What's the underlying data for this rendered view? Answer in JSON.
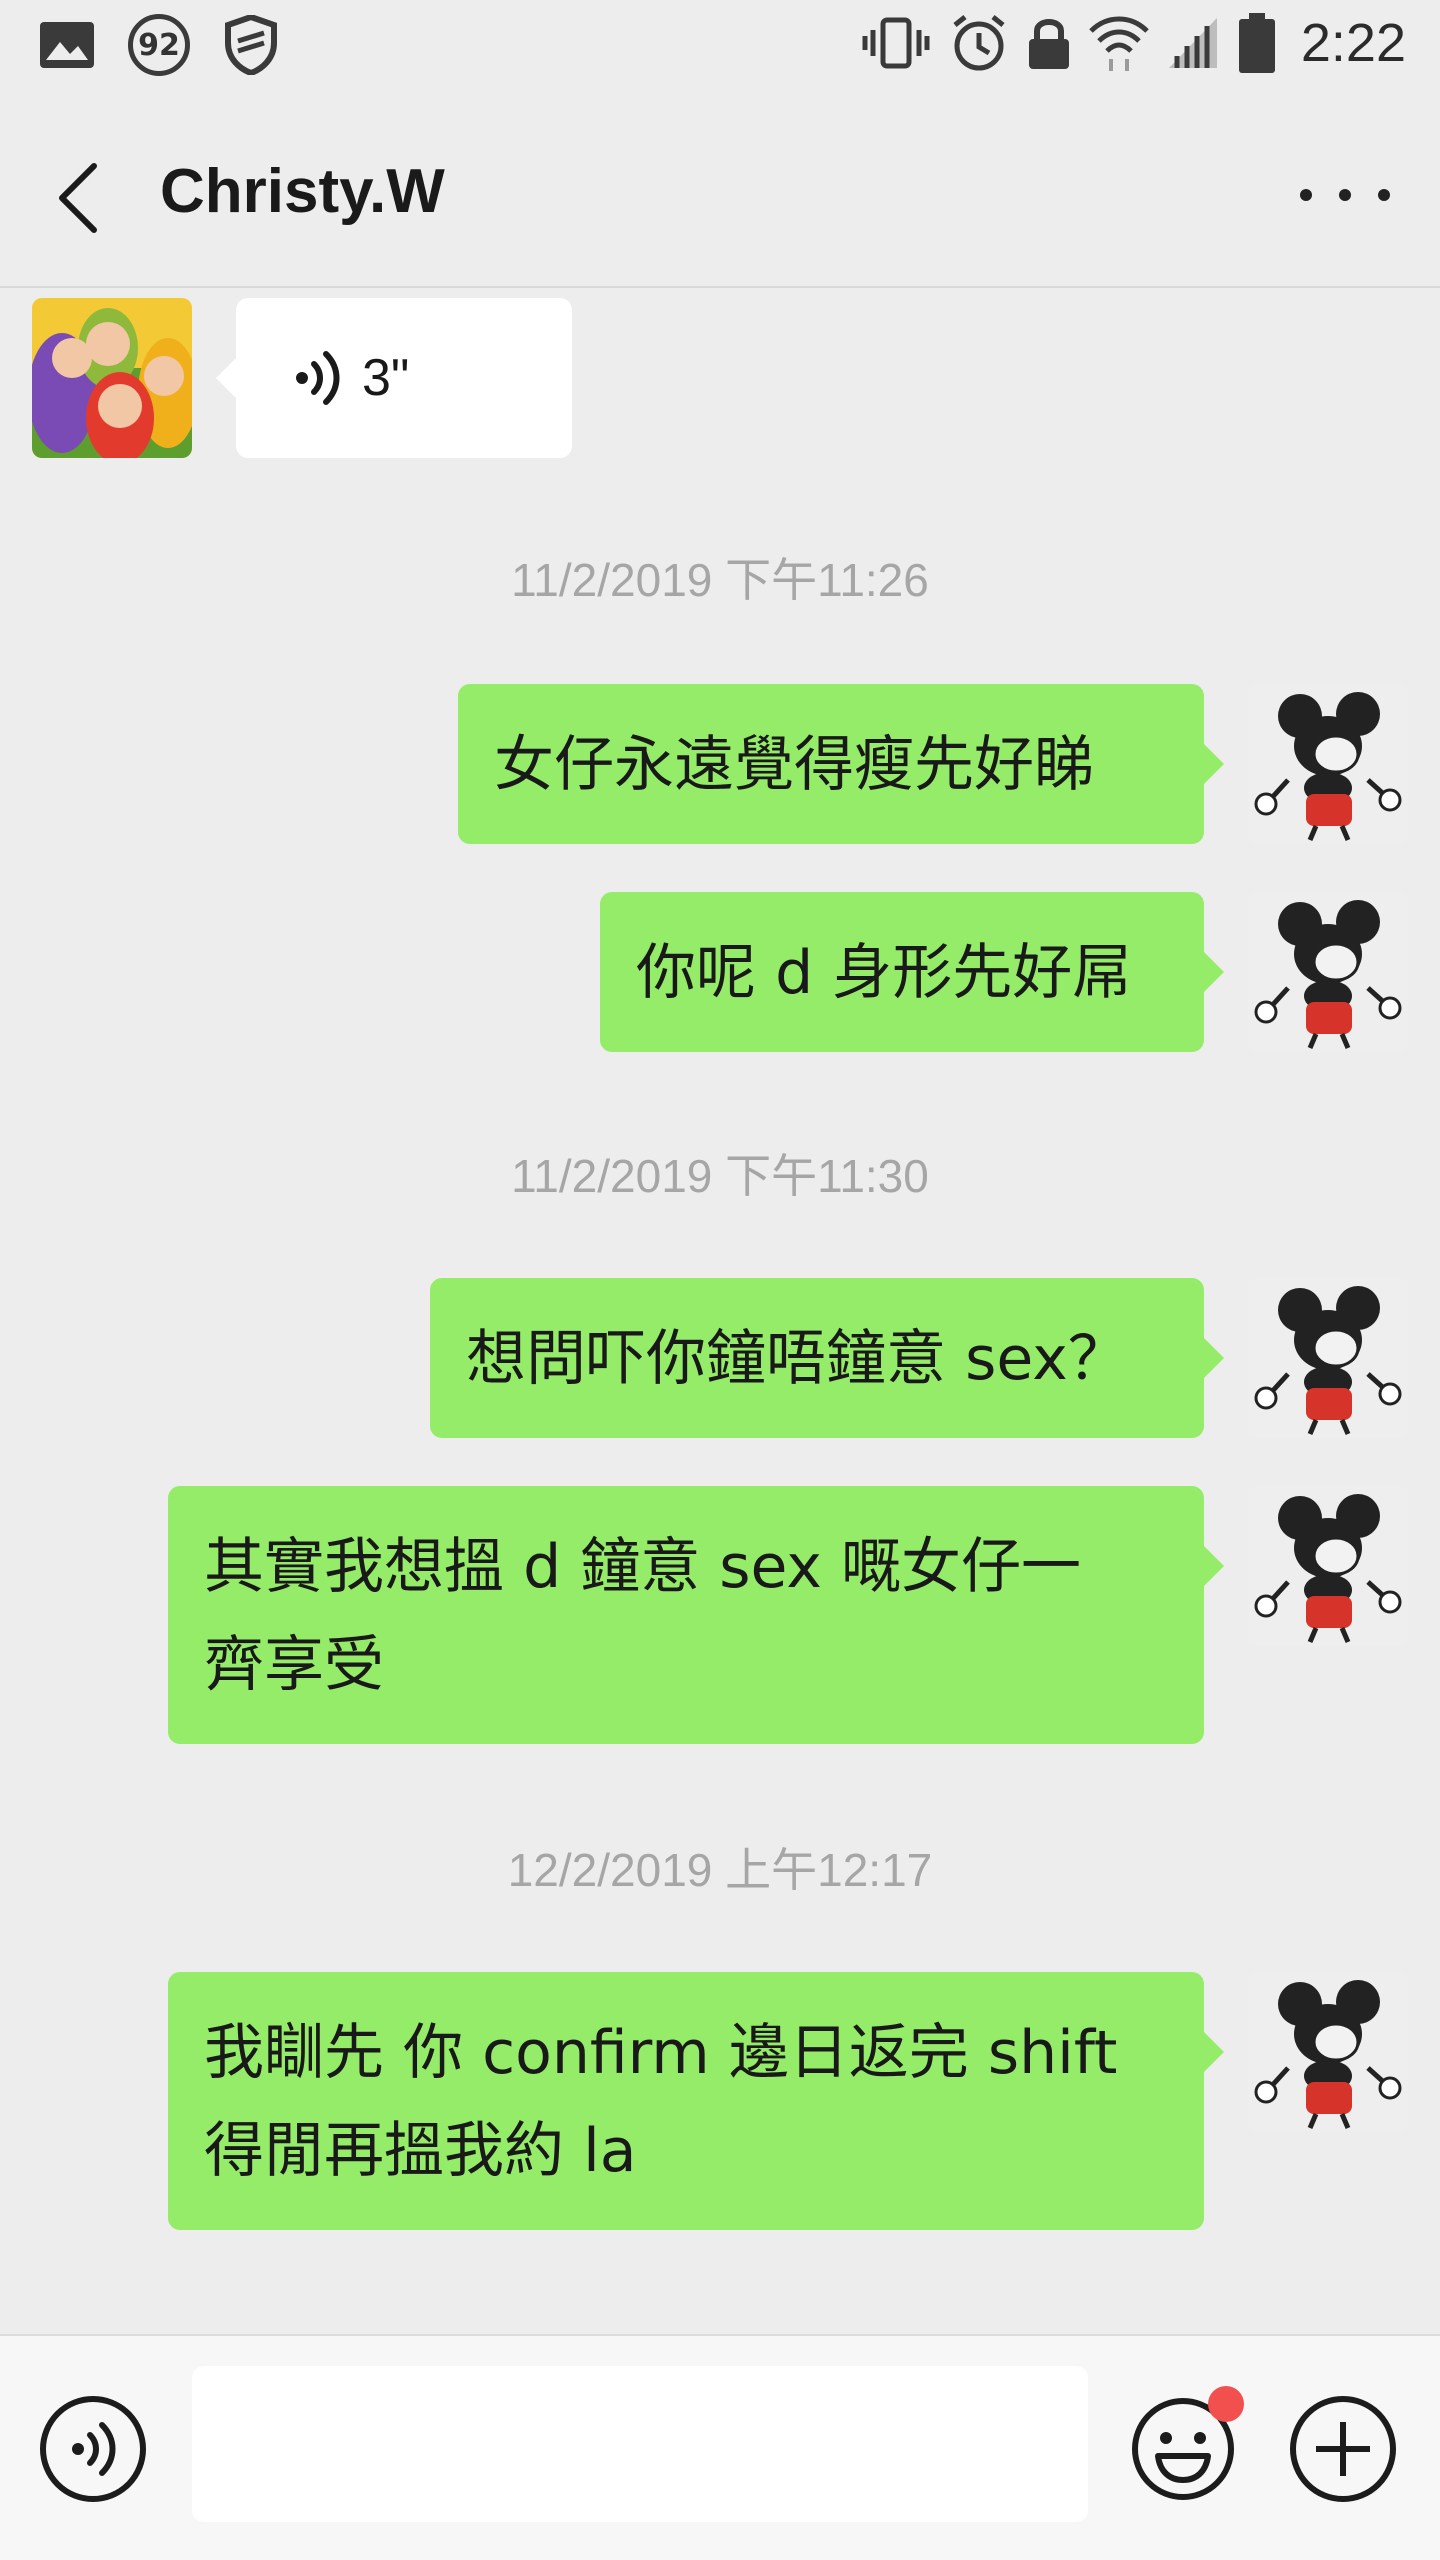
{
  "status_bar": {
    "time": "2:22",
    "notification_count": "92",
    "icons": [
      "image-icon",
      "shield-icon",
      "vibrate-icon",
      "alarm-icon",
      "lock-icon",
      "wifi-icon",
      "signal-icon",
      "battery-icon"
    ]
  },
  "header": {
    "title": "Christy.W",
    "back_icon": "chevron-left-icon",
    "more_icon": "more-dots-icon"
  },
  "messages": [
    {
      "type": "voice",
      "sender": "them",
      "duration": "3\""
    },
    {
      "type": "timestamp",
      "text": "11/2/2019 下午11:26"
    },
    {
      "type": "text",
      "sender": "me",
      "text": "女仔永遠覺得瘦先好睇"
    },
    {
      "type": "text",
      "sender": "me",
      "text": "你呢 d 身形先好屌"
    },
    {
      "type": "timestamp",
      "text": "11/2/2019 下午11:30"
    },
    {
      "type": "text",
      "sender": "me",
      "text": "想問吓你鐘唔鐘意 sex？"
    },
    {
      "type": "text",
      "sender": "me",
      "lines": [
        "其實我想搵 d 鐘意 sex 嘅女仔一",
        "齊享受"
      ]
    },
    {
      "type": "timestamp",
      "text": "12/2/2019 上午12:17"
    },
    {
      "type": "text",
      "sender": "me",
      "lines": [
        "我瞓先 你 confirm 邊日返完 shift",
        "得閒再搵我約 la"
      ]
    }
  ],
  "input_bar": {
    "voice_icon": "voice-input-icon",
    "text_value": "",
    "emoji_icon": "emoji-icon",
    "plus_icon": "plus-icon",
    "accent": "#95ec69",
    "badge_color": "#f24f4f"
  }
}
